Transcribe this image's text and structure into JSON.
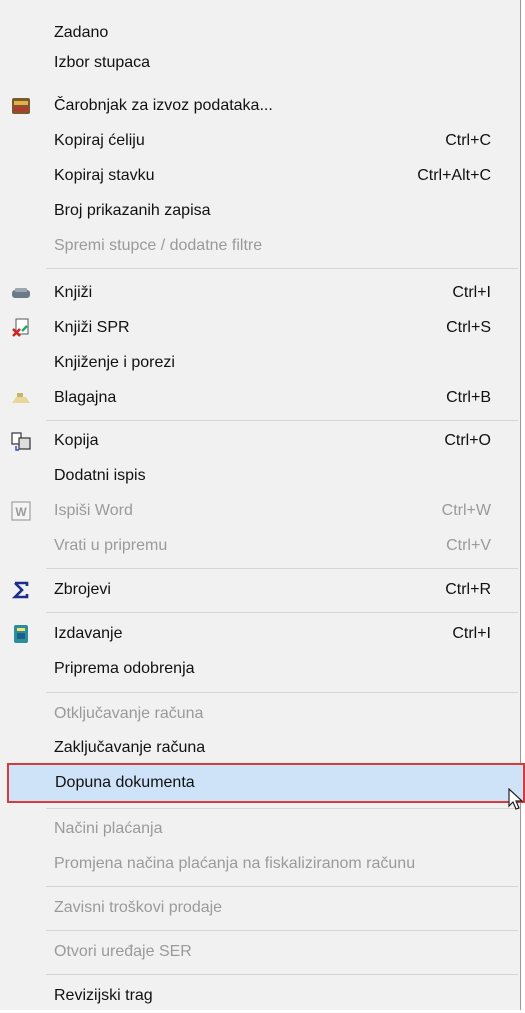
{
  "menu": {
    "items": [
      {
        "label": "Zadano",
        "shortcut": "",
        "enabled": true,
        "icon": ""
      },
      {
        "label": "Izbor stupaca",
        "shortcut": "",
        "enabled": true,
        "icon": ""
      },
      {
        "label": "Čarobnjak za izvoz podataka...",
        "shortcut": "",
        "enabled": true,
        "icon": "export-wizard-icon"
      },
      {
        "label": "Kopiraj ćeliju",
        "shortcut": "Ctrl+C",
        "enabled": true,
        "icon": ""
      },
      {
        "label": "Kopiraj stavku",
        "shortcut": "Ctrl+Alt+C",
        "enabled": true,
        "icon": ""
      },
      {
        "label": "Broj prikazanih zapisa",
        "shortcut": "",
        "enabled": true,
        "icon": ""
      },
      {
        "label": "Spremi stupce / dodatne filtre",
        "shortcut": "",
        "enabled": false,
        "icon": ""
      },
      {
        "label": "Knjiži",
        "shortcut": "Ctrl+I",
        "enabled": true,
        "icon": "post-icon"
      },
      {
        "label": "Knjiži SPR",
        "shortcut": "Ctrl+S",
        "enabled": true,
        "icon": "post-spr-icon"
      },
      {
        "label": "Knjiženje i porezi",
        "shortcut": "",
        "enabled": true,
        "icon": ""
      },
      {
        "label": "Blagajna",
        "shortcut": "Ctrl+B",
        "enabled": true,
        "icon": "cash-register-icon"
      },
      {
        "label": "Kopija",
        "shortcut": "Ctrl+O",
        "enabled": true,
        "icon": "copy-doc-icon"
      },
      {
        "label": "Dodatni ispis",
        "shortcut": "",
        "enabled": true,
        "icon": ""
      },
      {
        "label": "Ispiši Word",
        "shortcut": "Ctrl+W",
        "enabled": false,
        "icon": "word-icon"
      },
      {
        "label": "Vrati u pripremu",
        "shortcut": "Ctrl+V",
        "enabled": false,
        "icon": ""
      },
      {
        "label": "Zbrojevi",
        "shortcut": "Ctrl+R",
        "enabled": true,
        "icon": "sigma-icon"
      },
      {
        "label": "Izdavanje",
        "shortcut": "Ctrl+I",
        "enabled": true,
        "icon": "issue-icon"
      },
      {
        "label": "Priprema odobrenja",
        "shortcut": "",
        "enabled": true,
        "icon": ""
      },
      {
        "label": "Otključavanje računa",
        "shortcut": "",
        "enabled": false,
        "icon": ""
      },
      {
        "label": "Zaključavanje računa",
        "shortcut": "",
        "enabled": true,
        "icon": ""
      },
      {
        "label": "Dopuna dokumenta",
        "shortcut": "",
        "enabled": true,
        "icon": "",
        "highlighted": true
      },
      {
        "label": "Načini plaćanja",
        "shortcut": "",
        "enabled": false,
        "icon": ""
      },
      {
        "label": "Promjena načina plaćanja  na fiskaliziranom računu",
        "shortcut": "",
        "enabled": false,
        "icon": ""
      },
      {
        "label": "Zavisni troškovi prodaje",
        "shortcut": "",
        "enabled": false,
        "icon": ""
      },
      {
        "label": "Otvori uređaje SER",
        "shortcut": "",
        "enabled": false,
        "icon": ""
      },
      {
        "label": "Revizijski trag",
        "shortcut": "",
        "enabled": true,
        "icon": ""
      }
    ]
  },
  "colors": {
    "menu_background": "#f1f1f1",
    "highlight_background": "#cfe3f8",
    "highlight_border": "#d43b3b",
    "disabled_text": "#9a9a9a"
  }
}
